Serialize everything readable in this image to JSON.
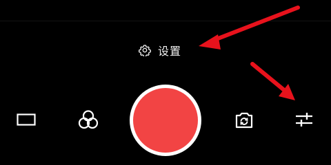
{
  "settings": {
    "label": "设置",
    "icon": "gear-icon"
  },
  "controls": {
    "aspect_ratio_icon": "aspect-ratio-icon",
    "filter_icon": "filter-icon",
    "shutter_icon": "record-shutter",
    "switch_camera_icon": "switch-camera-icon",
    "adjust_icon": "sliders-icon"
  },
  "colors": {
    "background": "#000000",
    "shutter_fill": "#f24444",
    "shutter_ring": "#ffffff",
    "annotation_arrow": "#e8121c",
    "icon": "#ffffff"
  }
}
